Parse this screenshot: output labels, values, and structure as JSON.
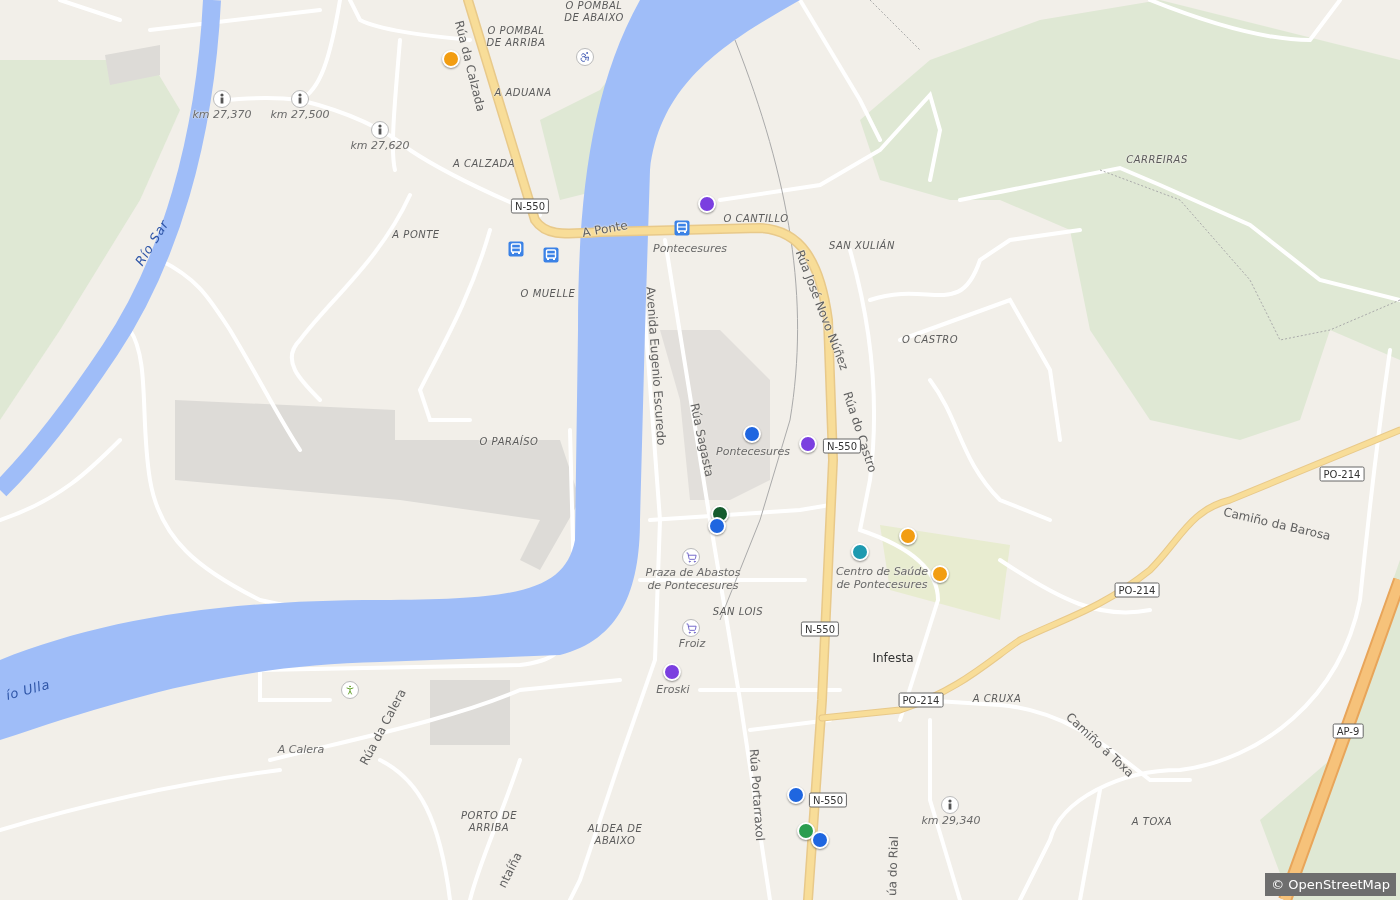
{
  "map": {
    "labels": [
      {
        "kind": "locality",
        "text": "O POMBAL DE ABAIXO"
      },
      {
        "kind": "locality",
        "text": "O POMBAL DE ARRIBA"
      },
      {
        "kind": "locality",
        "text": "A ADUANA"
      },
      {
        "kind": "locality",
        "text": "A CALZADA"
      },
      {
        "kind": "locality",
        "text": "A PONTE"
      },
      {
        "kind": "locality",
        "text": "O MUELLE"
      },
      {
        "kind": "locality",
        "text": "O PARAÍSO"
      },
      {
        "kind": "locality",
        "text": "O CANTILLO"
      },
      {
        "kind": "locality",
        "text": "SAN XULIÁN"
      },
      {
        "kind": "locality",
        "text": "CARREIRAS"
      },
      {
        "kind": "locality",
        "text": "O CASTRO"
      },
      {
        "kind": "locality",
        "text": "SAN LOIS"
      },
      {
        "kind": "locality",
        "text": "PORTO DE ARRIBA"
      },
      {
        "kind": "locality",
        "text": "ALDEA DE ABAIXO"
      },
      {
        "kind": "locality",
        "text": "A CRUXA"
      },
      {
        "kind": "locality",
        "text": "A TOXA"
      },
      {
        "kind": "street",
        "text": "Rúa da Calzada"
      },
      {
        "kind": "street",
        "text": "A Ponte"
      },
      {
        "kind": "street",
        "text": "Avenida Eugenio Escuredo"
      },
      {
        "kind": "street",
        "text": "Rúa Sagasta"
      },
      {
        "kind": "street",
        "text": "Rúa José Novo Núñez"
      },
      {
        "kind": "street",
        "text": "Rúa do Castro"
      },
      {
        "kind": "street",
        "text": "Camiño da Barosa"
      },
      {
        "kind": "street",
        "text": "Camiño á Toxa"
      },
      {
        "kind": "street",
        "text": "Rúa Portarraxol"
      },
      {
        "kind": "street",
        "text": "Rúa da Calera"
      },
      {
        "kind": "street",
        "text": "ntaíña"
      },
      {
        "kind": "street",
        "text": "úa do Rial"
      },
      {
        "kind": "water",
        "text": "Río Sar"
      },
      {
        "kind": "water",
        "text": "ío Ulla"
      },
      {
        "kind": "poi",
        "text": "A Calera"
      },
      {
        "kind": "poi",
        "text": "Pontecesures"
      },
      {
        "kind": "poi",
        "text": "Pontecesures"
      },
      {
        "kind": "poi",
        "text": "Praza de Abastos de Pontecesures"
      },
      {
        "kind": "poi",
        "text": "Centro de Saúde de Pontecesures"
      },
      {
        "kind": "poi",
        "text": "Froiz"
      },
      {
        "kind": "poi",
        "text": "Eroski"
      },
      {
        "kind": "poi",
        "text": "km 27,370"
      },
      {
        "kind": "poi",
        "text": "km 27,500"
      },
      {
        "kind": "poi",
        "text": "km 27,620"
      },
      {
        "kind": "poi",
        "text": "km 29,340"
      },
      {
        "kind": "town",
        "text": "Infesta"
      },
      {
        "kind": "shield",
        "text": "N-550"
      },
      {
        "kind": "shield",
        "text": "N-550"
      },
      {
        "kind": "shield",
        "text": "N-550"
      },
      {
        "kind": "shield",
        "text": "N-550"
      },
      {
        "kind": "shield",
        "text": "PO-214"
      },
      {
        "kind": "shield",
        "text": "PO-214"
      },
      {
        "kind": "shield",
        "text": "PO-214"
      },
      {
        "kind": "shield",
        "text": "AP-9"
      }
    ],
    "markers": [
      {
        "color": "#f29d12"
      },
      {
        "color": "#7b3fe0"
      },
      {
        "color": "#1f66e0"
      },
      {
        "color": "#7b3fe0"
      },
      {
        "color": "#155c2e"
      },
      {
        "color": "#1f66e0"
      },
      {
        "color": "#1e9ab0"
      },
      {
        "color": "#f29d12"
      },
      {
        "color": "#f29d12"
      },
      {
        "color": "#7b3fe0"
      },
      {
        "color": "#1f66e0"
      },
      {
        "color": "#2a9d4f"
      },
      {
        "color": "#1f66e0"
      }
    ],
    "attribution": "© OpenStreetMap"
  }
}
